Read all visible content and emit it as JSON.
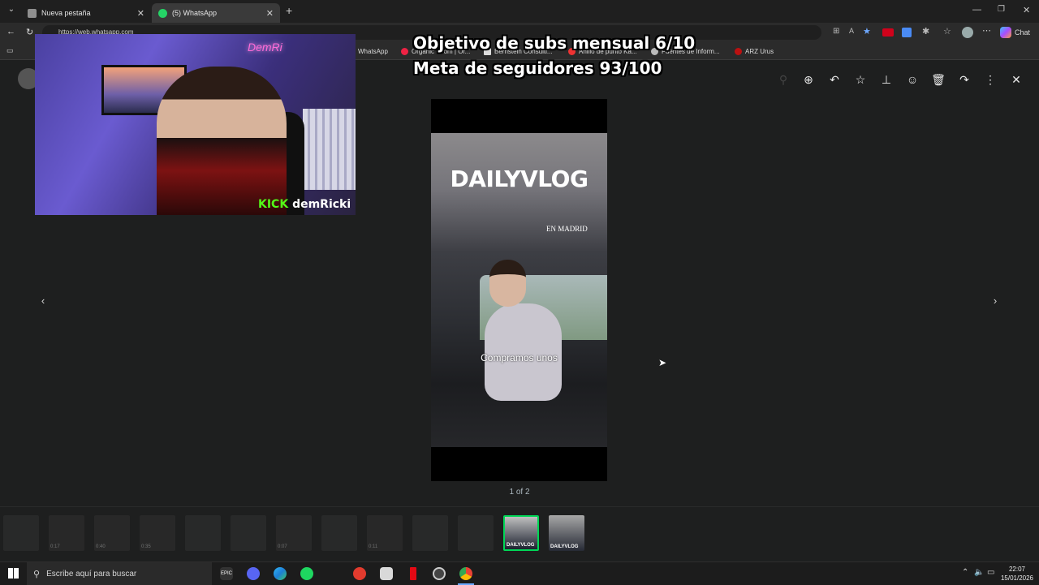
{
  "browser": {
    "tabs": [
      {
        "label": "Nueva pestaña",
        "active": false
      },
      {
        "label": "(5) WhatsApp",
        "active": true
      }
    ],
    "url": "https://web.whatsapp.com",
    "chat_button": "Chat",
    "bookmarks": [
      "WhatsApp",
      "Organic Ecom | Or...",
      "Bernstein Consulti...",
      "Anillo de punto Ka...",
      "Fuentes de Inform...",
      "ARZ Urus"
    ]
  },
  "stream": {
    "goal_line1": "Objetivo de subs mensual 6/10",
    "goal_line2": "Meta de seguidores 93/100",
    "kick_brand": "KICK",
    "kick_user": "demRicki",
    "neon_sign": "DemRi"
  },
  "viewer": {
    "toolbar_icons": [
      "zoom-in-icon",
      "reply-icon",
      "star-icon",
      "pin-icon",
      "emoji-icon",
      "delete-icon",
      "forward-icon",
      "more-icon",
      "close-icon"
    ],
    "media_title": "DAILYVLOG",
    "media_subtitle": "EN MADRID",
    "caption": "Compramos unos",
    "counter": "1 of 2",
    "prev_glyph": "‹",
    "next_glyph": "›",
    "thumbnails": [
      {
        "duration": ""
      },
      {
        "duration": "0:17"
      },
      {
        "duration": "0:40"
      },
      {
        "duration": "0:35"
      },
      {
        "duration": ""
      },
      {
        "duration": ""
      },
      {
        "duration": "0:07"
      },
      {
        "duration": ""
      },
      {
        "duration": "0:11"
      },
      {
        "duration": ""
      },
      {
        "duration": ""
      },
      {
        "duration": "",
        "label": "DAILYVLOG",
        "selected": true
      },
      {
        "duration": "",
        "label": "DAILYVLOG"
      }
    ]
  },
  "taskbar": {
    "search_placeholder": "Escribe aquí para buscar",
    "time": "22:07",
    "date": "15/01/2026"
  },
  "colors": {
    "accent_green": "#00d756",
    "kick_green": "#53fc18"
  }
}
